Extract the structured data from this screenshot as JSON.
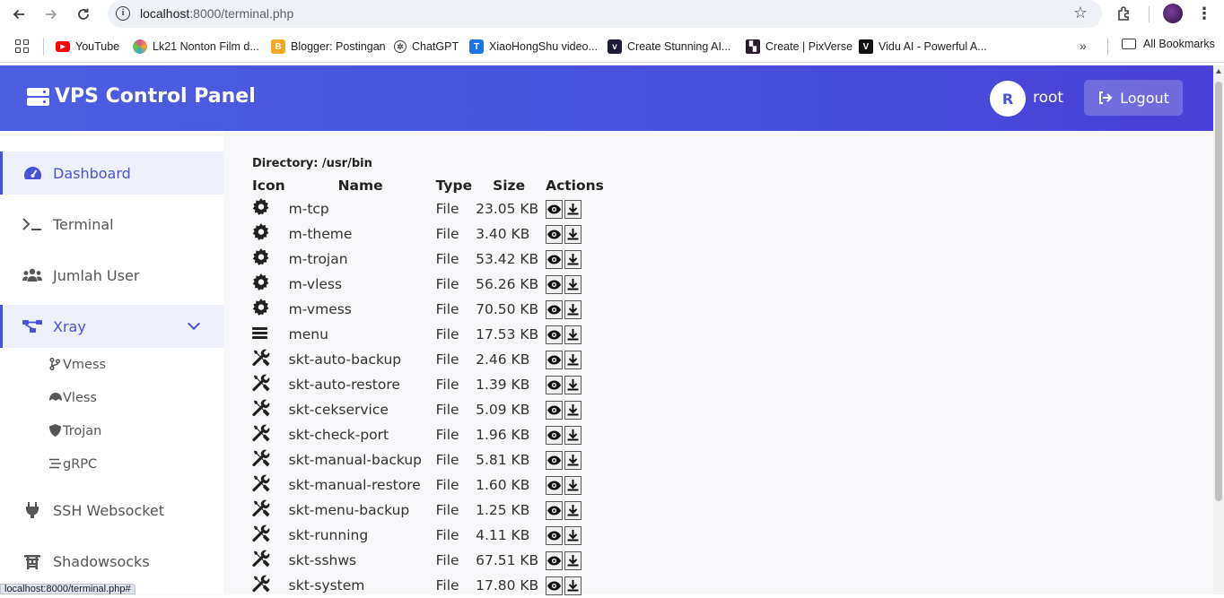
{
  "browser": {
    "url_host": "localhost",
    "url_rest": ":8000/terminal.php",
    "status_url": "localhost:8000/terminal.php#",
    "bookmarks": [
      {
        "label": "YouTube",
        "icon": "youtube-icon",
        "color": "#ff0000"
      },
      {
        "label": "Lk21 Nonton Film d...",
        "icon": "lk21-icon",
        "color": "#e34c9b"
      },
      {
        "label": "Blogger: Postingan",
        "icon": "blogger-icon",
        "color": "#f5a623"
      },
      {
        "label": "ChatGPT",
        "icon": "chatgpt-icon",
        "color": "#444444"
      },
      {
        "label": "XiaoHongShu video...",
        "icon": "xiaohongshu-icon",
        "color": "#1a73e8"
      },
      {
        "label": "Create Stunning AI...",
        "icon": "ai-icon",
        "color": "#1c1c3a"
      },
      {
        "label": "Create | PixVerse",
        "icon": "pixverse-icon",
        "color": "#2b1a2e"
      },
      {
        "label": "Vidu AI - Powerful A...",
        "icon": "vidu-icon",
        "color": "#111111"
      }
    ],
    "all_bookmarks": "All Bookmarks"
  },
  "header": {
    "title": "VPS Control Panel",
    "avatar_initial": "R",
    "username": "root",
    "logout_label": "Logout",
    "accent": "#4752dd"
  },
  "sidebar": {
    "items": [
      {
        "label": "Dashboard",
        "icon": "dashboard-gauge-icon"
      },
      {
        "label": "Terminal",
        "icon": "terminal-icon"
      },
      {
        "label": "Jumlah User",
        "icon": "users-icon"
      },
      {
        "label": "Xray",
        "icon": "network-icon"
      },
      {
        "label": "SSH Websocket",
        "icon": "plug-icon"
      },
      {
        "label": "Shadowsocks",
        "icon": "torii-icon"
      }
    ],
    "sub_items": [
      {
        "label": "Vmess",
        "icon": "branch-icon"
      },
      {
        "label": "Vless",
        "icon": "mask-icon"
      },
      {
        "label": "Trojan",
        "icon": "shield-icon"
      },
      {
        "label": "gRPC",
        "icon": "stream-icon"
      }
    ]
  },
  "main": {
    "directory_label": "Directory: /usr/bin",
    "columns": [
      "Icon",
      "Name",
      "Type",
      "Size",
      "Actions"
    ],
    "files": [
      {
        "icon": "gear",
        "name": "m-tcp",
        "type": "File",
        "size": "23.05 KB"
      },
      {
        "icon": "gear",
        "name": "m-theme",
        "type": "File",
        "size": "3.40 KB"
      },
      {
        "icon": "gear",
        "name": "m-trojan",
        "type": "File",
        "size": "53.42 KB"
      },
      {
        "icon": "gear",
        "name": "m-vless",
        "type": "File",
        "size": "56.26 KB"
      },
      {
        "icon": "gear",
        "name": "m-vmess",
        "type": "File",
        "size": "70.50 KB"
      },
      {
        "icon": "menu",
        "name": "menu",
        "type": "File",
        "size": "17.53 KB"
      },
      {
        "icon": "tools",
        "name": "skt-auto-backup",
        "type": "File",
        "size": "2.46 KB"
      },
      {
        "icon": "tools",
        "name": "skt-auto-restore",
        "type": "File",
        "size": "1.39 KB"
      },
      {
        "icon": "tools",
        "name": "skt-cekservice",
        "type": "File",
        "size": "5.09 KB"
      },
      {
        "icon": "tools",
        "name": "skt-check-port",
        "type": "File",
        "size": "1.96 KB"
      },
      {
        "icon": "tools",
        "name": "skt-manual-backup",
        "type": "File",
        "size": "5.81 KB"
      },
      {
        "icon": "tools",
        "name": "skt-manual-restore",
        "type": "File",
        "size": "1.60 KB"
      },
      {
        "icon": "tools",
        "name": "skt-menu-backup",
        "type": "File",
        "size": "1.25 KB"
      },
      {
        "icon": "tools",
        "name": "skt-running",
        "type": "File",
        "size": "4.11 KB"
      },
      {
        "icon": "tools",
        "name": "skt-sshws",
        "type": "File",
        "size": "67.51 KB"
      },
      {
        "icon": "tools",
        "name": "skt-system",
        "type": "File",
        "size": "17.80 KB"
      }
    ]
  }
}
